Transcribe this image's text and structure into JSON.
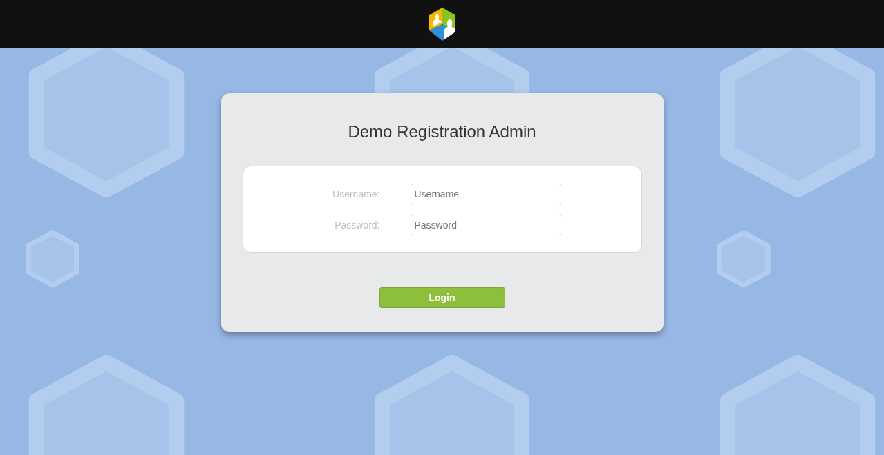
{
  "login": {
    "title": "Demo Registration Admin",
    "fields": [
      {
        "label": "Username:",
        "placeholder": "Username"
      },
      {
        "label": "Password:",
        "placeholder": "Password"
      }
    ],
    "button": "Login"
  }
}
